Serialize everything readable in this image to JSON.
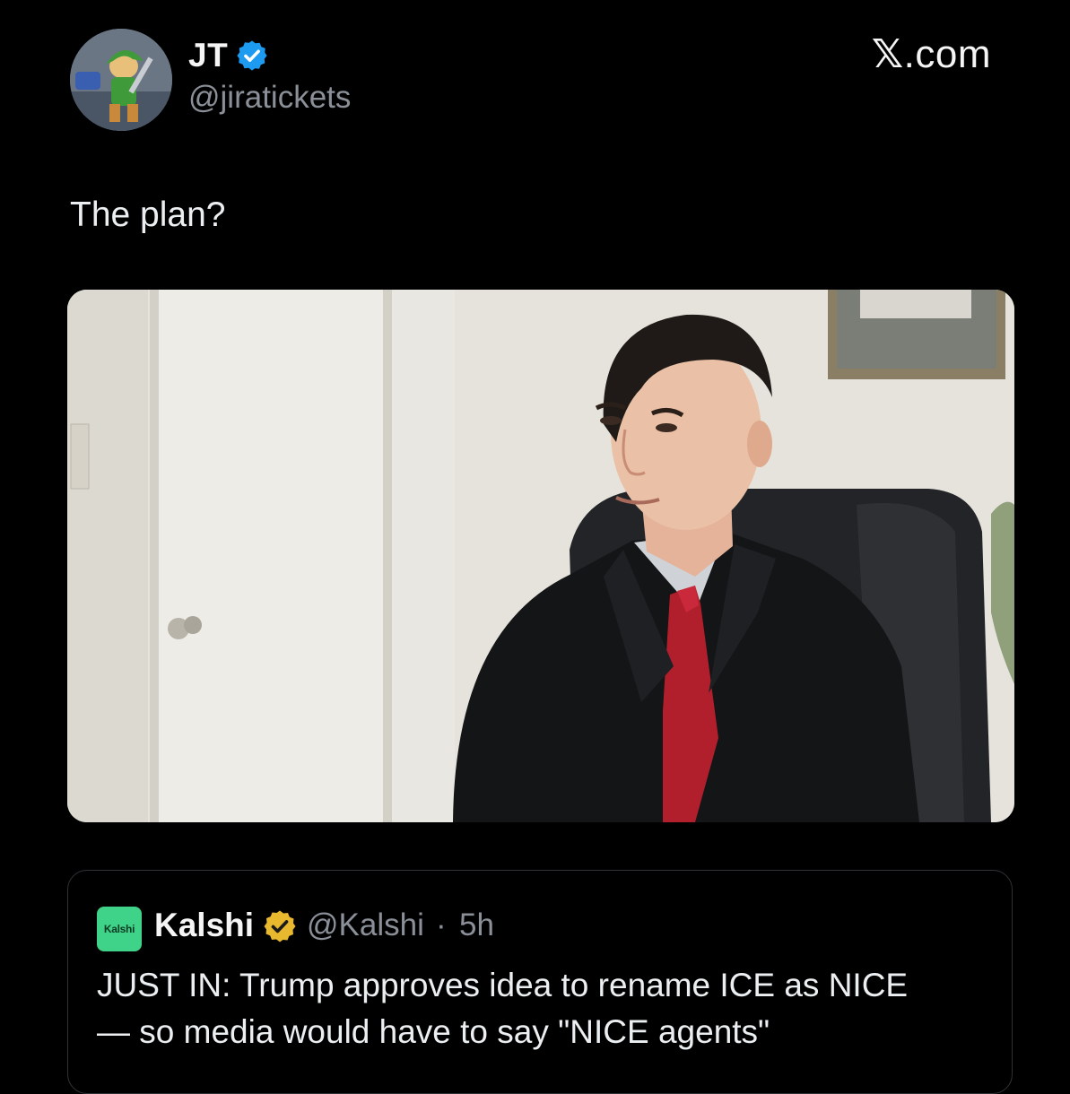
{
  "author": {
    "name": "JT",
    "handle": "@jiratickets",
    "verified_color": "#1d9bf0"
  },
  "site": {
    "label": ".com",
    "x_glyph": "𝕏"
  },
  "tweet": {
    "text": "The plan?"
  },
  "media": {
    "kind": "photo"
  },
  "quote": {
    "logo_text": "Kalshi",
    "name": "Kalshi",
    "handle": "@Kalshi",
    "separator": "·",
    "time": "5h",
    "verified_color": "#e8b92f",
    "text_lines": [
      "JUST IN: Trump approves idea to rename ICE as NICE",
      "— so media would have to say \"NICE agents\""
    ]
  },
  "colors": {
    "background": "#000000",
    "text_primary": "#eceff1",
    "text_secondary": "#8b9098",
    "border": "#2f3336",
    "kalshi_green": "#3fd38a"
  }
}
